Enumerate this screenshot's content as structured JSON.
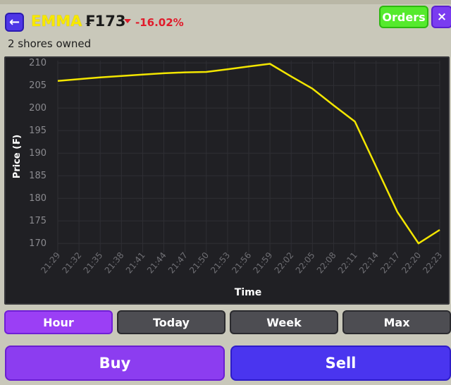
{
  "header": {
    "back_icon": "arrow-left-icon",
    "ticker": "EMMA",
    "price": "₣173",
    "change_direction_icon": "triangle-down-icon",
    "change": "-16.02%",
    "orders_label": "Orders",
    "close_label": "×"
  },
  "holdings": {
    "owned_text": "2 shores owned"
  },
  "colors": {
    "accent_purple": "#9b3ff5",
    "sell_blue": "#4a35ef",
    "orders_green": "#55ea2d",
    "line_yellow": "#f3e600",
    "negative_red": "#e01b2b"
  },
  "range_buttons": [
    {
      "label": "Hour",
      "active": true
    },
    {
      "label": "Today",
      "active": false
    },
    {
      "label": "Week",
      "active": false
    },
    {
      "label": "Max",
      "active": false
    }
  ],
  "actions": {
    "buy_label": "Buy",
    "sell_label": "Sell"
  },
  "chart_data": {
    "type": "line",
    "xlabel": "Time",
    "ylabel": "Price (₣)",
    "x": [
      "21:29",
      "21:32",
      "21:35",
      "21:38",
      "21:41",
      "21:44",
      "21:47",
      "21:50",
      "21:53",
      "21:56",
      "21:59",
      "22:02",
      "22:05",
      "22:08",
      "22:11",
      "22:14",
      "22:17",
      "22:20",
      "22:23"
    ],
    "ylim": [
      168,
      210.5
    ],
    "yticks": [
      170,
      175,
      180,
      185,
      190,
      195,
      200,
      205,
      210
    ],
    "grid": true,
    "series": [
      {
        "values": [
          206,
          206.4,
          206.8,
          207.1,
          207.4,
          207.7,
          207.9,
          208,
          208.6,
          209.2,
          209.8,
          207,
          204.3,
          200.6,
          197,
          187,
          177,
          170,
          173
        ]
      }
    ]
  }
}
